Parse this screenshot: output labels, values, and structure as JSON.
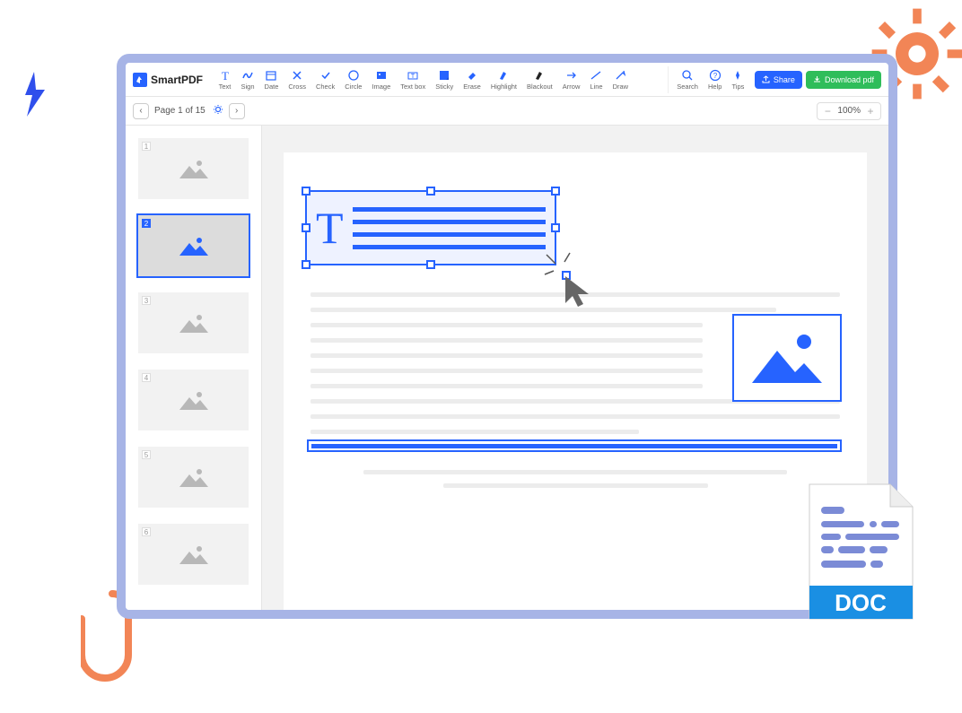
{
  "brand": "SmartPDF",
  "tools": [
    {
      "id": "text",
      "label": "Text"
    },
    {
      "id": "sign",
      "label": "Sign"
    },
    {
      "id": "date",
      "label": "Date"
    },
    {
      "id": "cross",
      "label": "Cross"
    },
    {
      "id": "check",
      "label": "Check"
    },
    {
      "id": "circle",
      "label": "Circle"
    },
    {
      "id": "image",
      "label": "Image"
    },
    {
      "id": "textbox",
      "label": "Text box"
    },
    {
      "id": "sticky",
      "label": "Sticky"
    },
    {
      "id": "erase",
      "label": "Erase"
    },
    {
      "id": "highlight",
      "label": "Highlight"
    },
    {
      "id": "blackout",
      "label": "Blackout"
    },
    {
      "id": "arrow",
      "label": "Arrow"
    },
    {
      "id": "line",
      "label": "Line"
    },
    {
      "id": "draw",
      "label": "Draw"
    }
  ],
  "util_tools": [
    {
      "id": "search",
      "label": "Search"
    },
    {
      "id": "help",
      "label": "Help"
    },
    {
      "id": "tips",
      "label": "Tips"
    }
  ],
  "actions": {
    "share": "Share",
    "download": "Download pdf"
  },
  "pager": {
    "label": "Page 1 of 15"
  },
  "zoom": {
    "level": "100%"
  },
  "thumbnails": [
    1,
    2,
    3,
    4,
    5,
    6
  ],
  "active_thumb": 2,
  "doc_badge": "DOC"
}
